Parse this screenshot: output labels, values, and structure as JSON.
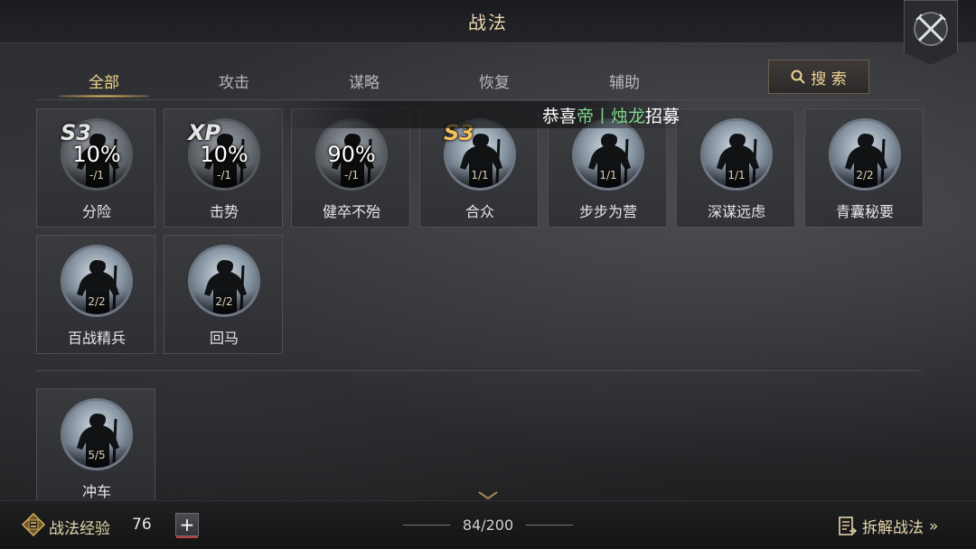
{
  "header": {
    "title": "战法"
  },
  "tabs": [
    {
      "label": "全部",
      "active": true
    },
    {
      "label": "攻击",
      "active": false
    },
    {
      "label": "谋略",
      "active": false
    },
    {
      "label": "恢复",
      "active": false
    },
    {
      "label": "辅助",
      "active": false
    }
  ],
  "search": {
    "label": "搜 索"
  },
  "announcement": {
    "prefix": "恭喜",
    "name_a": "帝",
    "sep": "丨",
    "name_b": "烛龙",
    "suffix": "招募"
  },
  "cards": [
    {
      "name": "分险",
      "count": "-/1",
      "percent": "10%",
      "badge": "S3",
      "badge_style": "white"
    },
    {
      "name": "击势",
      "count": "-/1",
      "percent": "10%",
      "badge": "XP",
      "badge_style": "xp"
    },
    {
      "name": "健卒不殆",
      "count": "-/1",
      "percent": "90%",
      "badge": "",
      "badge_style": ""
    },
    {
      "name": "合众",
      "count": "1/1",
      "percent": "",
      "badge": "S3",
      "badge_style": "gold"
    },
    {
      "name": "步步为营",
      "count": "1/1",
      "percent": "",
      "badge": "",
      "badge_style": ""
    },
    {
      "name": "深谋远虑",
      "count": "1/1",
      "percent": "",
      "badge": "",
      "badge_style": ""
    },
    {
      "name": "青囊秘要",
      "count": "2/2",
      "percent": "",
      "badge": "",
      "badge_style": ""
    },
    {
      "name": "百战精兵",
      "count": "2/2",
      "percent": "",
      "badge": "",
      "badge_style": ""
    },
    {
      "name": "回马",
      "count": "2/2",
      "percent": "",
      "badge": "",
      "badge_style": ""
    },
    {
      "name": "冲车",
      "count": "5/5",
      "percent": "",
      "badge": "",
      "badge_style": ""
    }
  ],
  "footer": {
    "exp_label": "战法经验",
    "exp_value": "76",
    "plus": "+",
    "capacity": "84/200",
    "dismantle_label": "拆解战法",
    "dismantle_arrow": "»"
  },
  "icons": {
    "close": "crossed-swords-icon",
    "search": "search-icon",
    "exp": "exp-coin-icon",
    "dismantle": "document-list-icon",
    "scroll": "chevron-down-icon"
  },
  "colors": {
    "accent": "#f2d58a",
    "badge_gold": "#f2c15c",
    "highlight_green": "#7fd48a"
  }
}
